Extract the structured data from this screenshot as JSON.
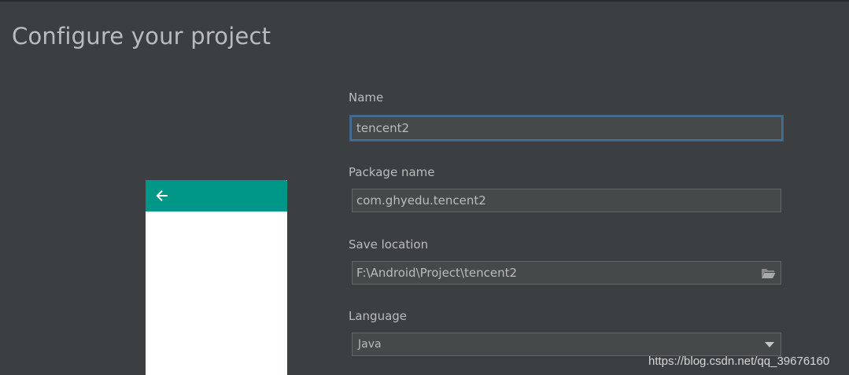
{
  "page": {
    "title": "Configure your project"
  },
  "preview": {
    "appbar_color": "#009688",
    "appbar_icon": "back-arrow-icon"
  },
  "form": {
    "name": {
      "label": "Name",
      "value": "tencent2"
    },
    "package_name": {
      "label": "Package name",
      "value": "com.ghyedu.tencent2"
    },
    "save_location": {
      "label": "Save location",
      "value": "F:\\Android\\Project\\tencent2",
      "browse_icon": "folder-icon"
    },
    "language": {
      "label": "Language",
      "selected": "Java"
    }
  },
  "watermark": {
    "text": "https://blog.csdn.net/qq_39676160"
  },
  "colors": {
    "background": "#3c3f41",
    "text": "#bbbbbb",
    "field_background": "#45494a",
    "focus_border": "#466d94"
  }
}
